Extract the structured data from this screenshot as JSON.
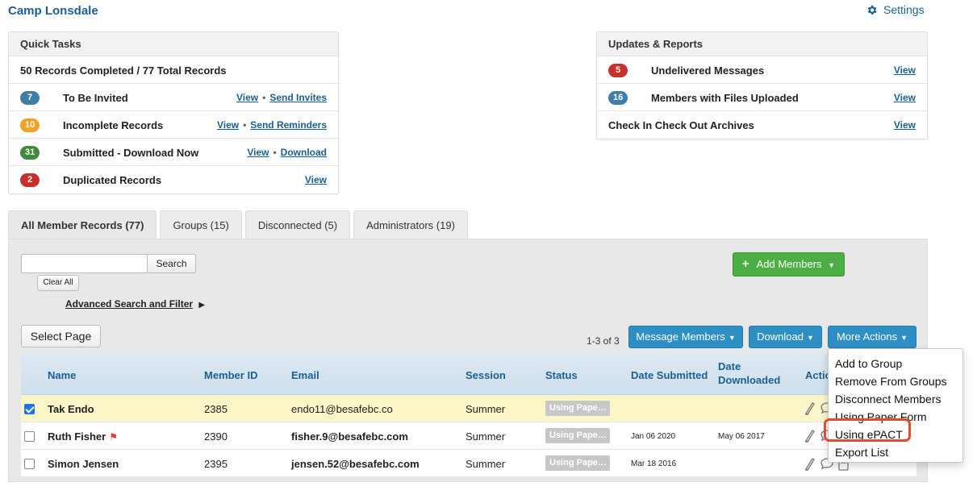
{
  "header": {
    "camp_name": "Camp Lonsdale",
    "settings_label": "Settings"
  },
  "quick_tasks": {
    "title": "Quick Tasks",
    "summary": "50 Records Completed / 77 Total Records",
    "rows": [
      {
        "count": "7",
        "label": "To Be Invited",
        "link1": "View",
        "link2": "Send Invites"
      },
      {
        "count": "10",
        "label": "Incomplete Records",
        "link1": "View",
        "link2": "Send Reminders"
      },
      {
        "count": "31",
        "label": "Submitted - Download Now",
        "link1": "View",
        "link2": "Download"
      },
      {
        "count": "2",
        "label": "Duplicated Records",
        "link1": "View"
      }
    ]
  },
  "updates": {
    "title": "Updates & Reports",
    "rows": [
      {
        "count": "5",
        "label": "Undelivered Messages",
        "link": "View"
      },
      {
        "count": "16",
        "label": "Members with Files Uploaded",
        "link": "View"
      },
      {
        "label": "Check In Check Out Archives",
        "link": "View"
      }
    ]
  },
  "tabs": [
    "All Member Records (77)",
    "Groups (15)",
    "Disconnected (5)",
    "Administrators (19)"
  ],
  "toolbar": {
    "search_label": "Search",
    "clear_label": "Clear All",
    "advanced_label": "Advanced Search and Filter",
    "advanced_arrow": "▶",
    "select_page": "Select Page",
    "add_members": "Add Members",
    "count": "1-3 of 3",
    "message_members": "Message Members",
    "download": "Download",
    "more_actions": "More Actions"
  },
  "table": {
    "headers": {
      "name": "Name",
      "member_id": "Member ID",
      "email": "Email",
      "session": "Session",
      "status": "Status",
      "date_submitted": "Date Submitted",
      "date_downloaded_1": "Date",
      "date_downloaded_2": "Downloaded",
      "actions": "Actio"
    },
    "rows": [
      {
        "name": "Tak Endo",
        "member_id": "2385",
        "email": "endo11@besafebc.co",
        "session": "Summer",
        "status": "Using Pape…",
        "date_submitted": "",
        "date_downloaded": ""
      },
      {
        "name": "Ruth Fisher",
        "member_id": "2390",
        "email": "fisher.9@besafebc.com",
        "session": "Summer",
        "status": "Using Pape…",
        "date_submitted": "Jan 06 2020",
        "date_downloaded": "May 06 2017"
      },
      {
        "name": "Simon Jensen",
        "member_id": "2395",
        "email": "jensen.52@besafebc.com",
        "session": "Summer",
        "status": "Using Pape…",
        "date_submitted": "Mar 18 2016",
        "date_downloaded": ""
      }
    ]
  },
  "more_actions_menu": [
    "Add to Group",
    "Remove From Groups",
    "Disconnect Members",
    "Using Paper Form",
    "Using ePACT",
    "Export List"
  ],
  "colors": {
    "link": "#1a5f94",
    "primary_button": "#2d8fc4",
    "add_button": "#4caf45",
    "highlight": "#e84b2c",
    "selected_row": "#fbf6c8"
  }
}
